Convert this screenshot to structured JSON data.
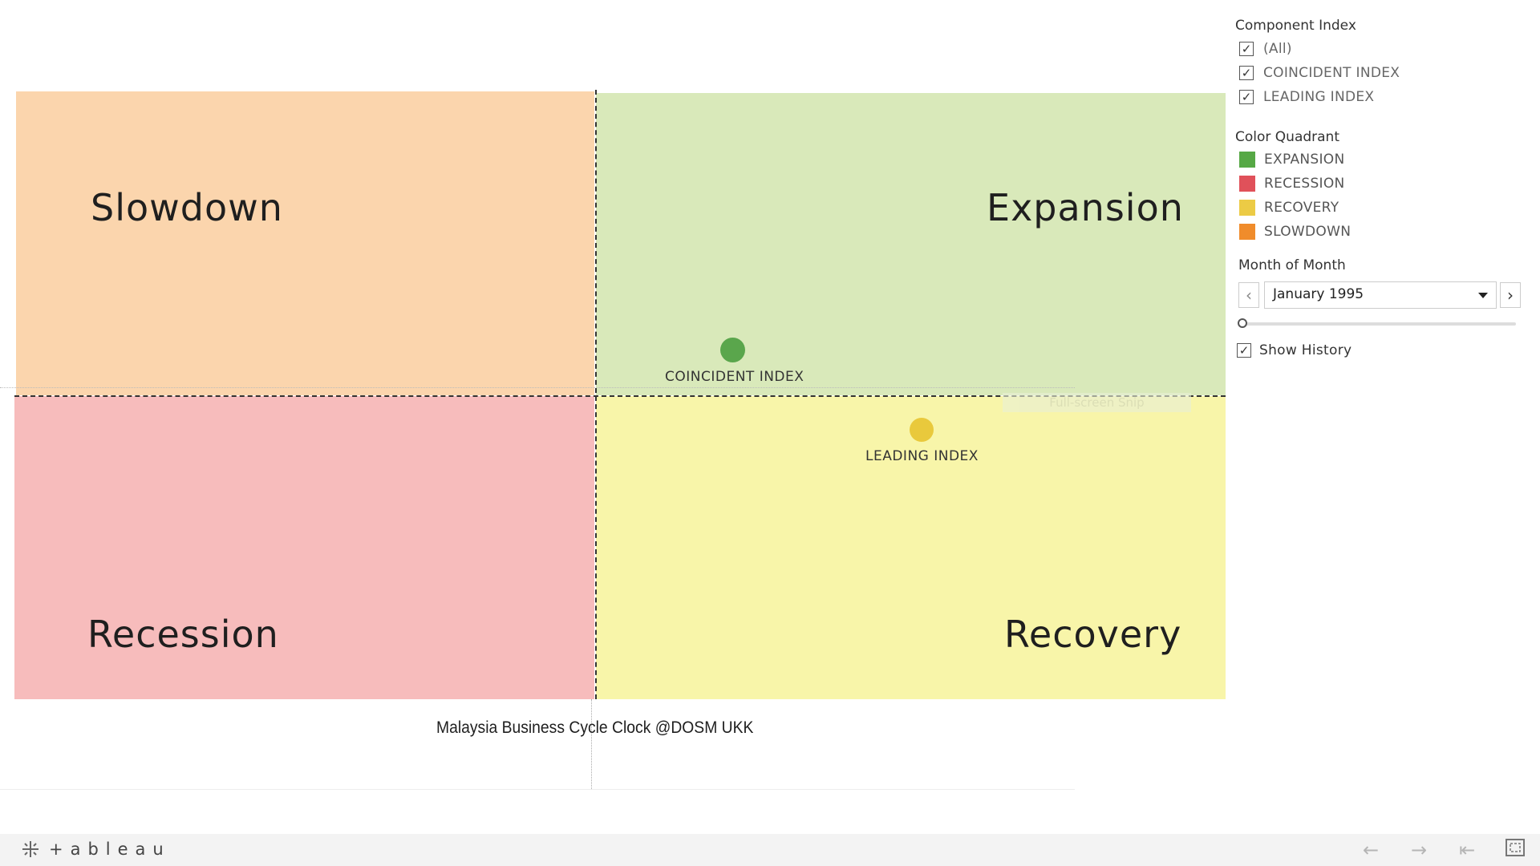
{
  "quadrants": {
    "slowdown": {
      "label": "Slowdown",
      "color": "#fbd5ad"
    },
    "expansion": {
      "label": "Expansion",
      "color": "#d9e9ba"
    },
    "recession": {
      "label": "Recession",
      "color": "#f7bcbc"
    },
    "recovery": {
      "label": "Recovery",
      "color": "#f8f5a9"
    }
  },
  "markers": [
    {
      "label": "COINCIDENT INDEX",
      "color": "#5aa64c"
    },
    {
      "label": "LEADING INDEX",
      "color": "#e9c93c"
    }
  ],
  "ghost_text": "Full-screen Snip",
  "caption": "Malaysia Business Cycle Clock @DOSM UKK",
  "filters": {
    "component_index": {
      "title": "Component Index",
      "options": [
        {
          "label": "(All)",
          "checked": true
        },
        {
          "label": "COINCIDENT INDEX",
          "checked": true
        },
        {
          "label": "LEADING INDEX",
          "checked": true
        }
      ]
    },
    "color_quadrant": {
      "title": "Color Quadrant",
      "items": [
        {
          "label": "EXPANSION",
          "color": "#56a845"
        },
        {
          "label": "RECESSION",
          "color": "#e0515a"
        },
        {
          "label": "RECOVERY",
          "color": "#eccb45"
        },
        {
          "label": "SLOWDOWN",
          "color": "#f08c2b"
        }
      ]
    },
    "month": {
      "title": "Month of Month",
      "selected": "January 1995",
      "slider_position": 0
    },
    "show_history": {
      "label": "Show History",
      "checked": true
    }
  },
  "footer": {
    "brand": "+ableau",
    "icons": [
      "undo-icon",
      "redo-icon",
      "revert-icon",
      "fullscreen-icon"
    ]
  }
}
